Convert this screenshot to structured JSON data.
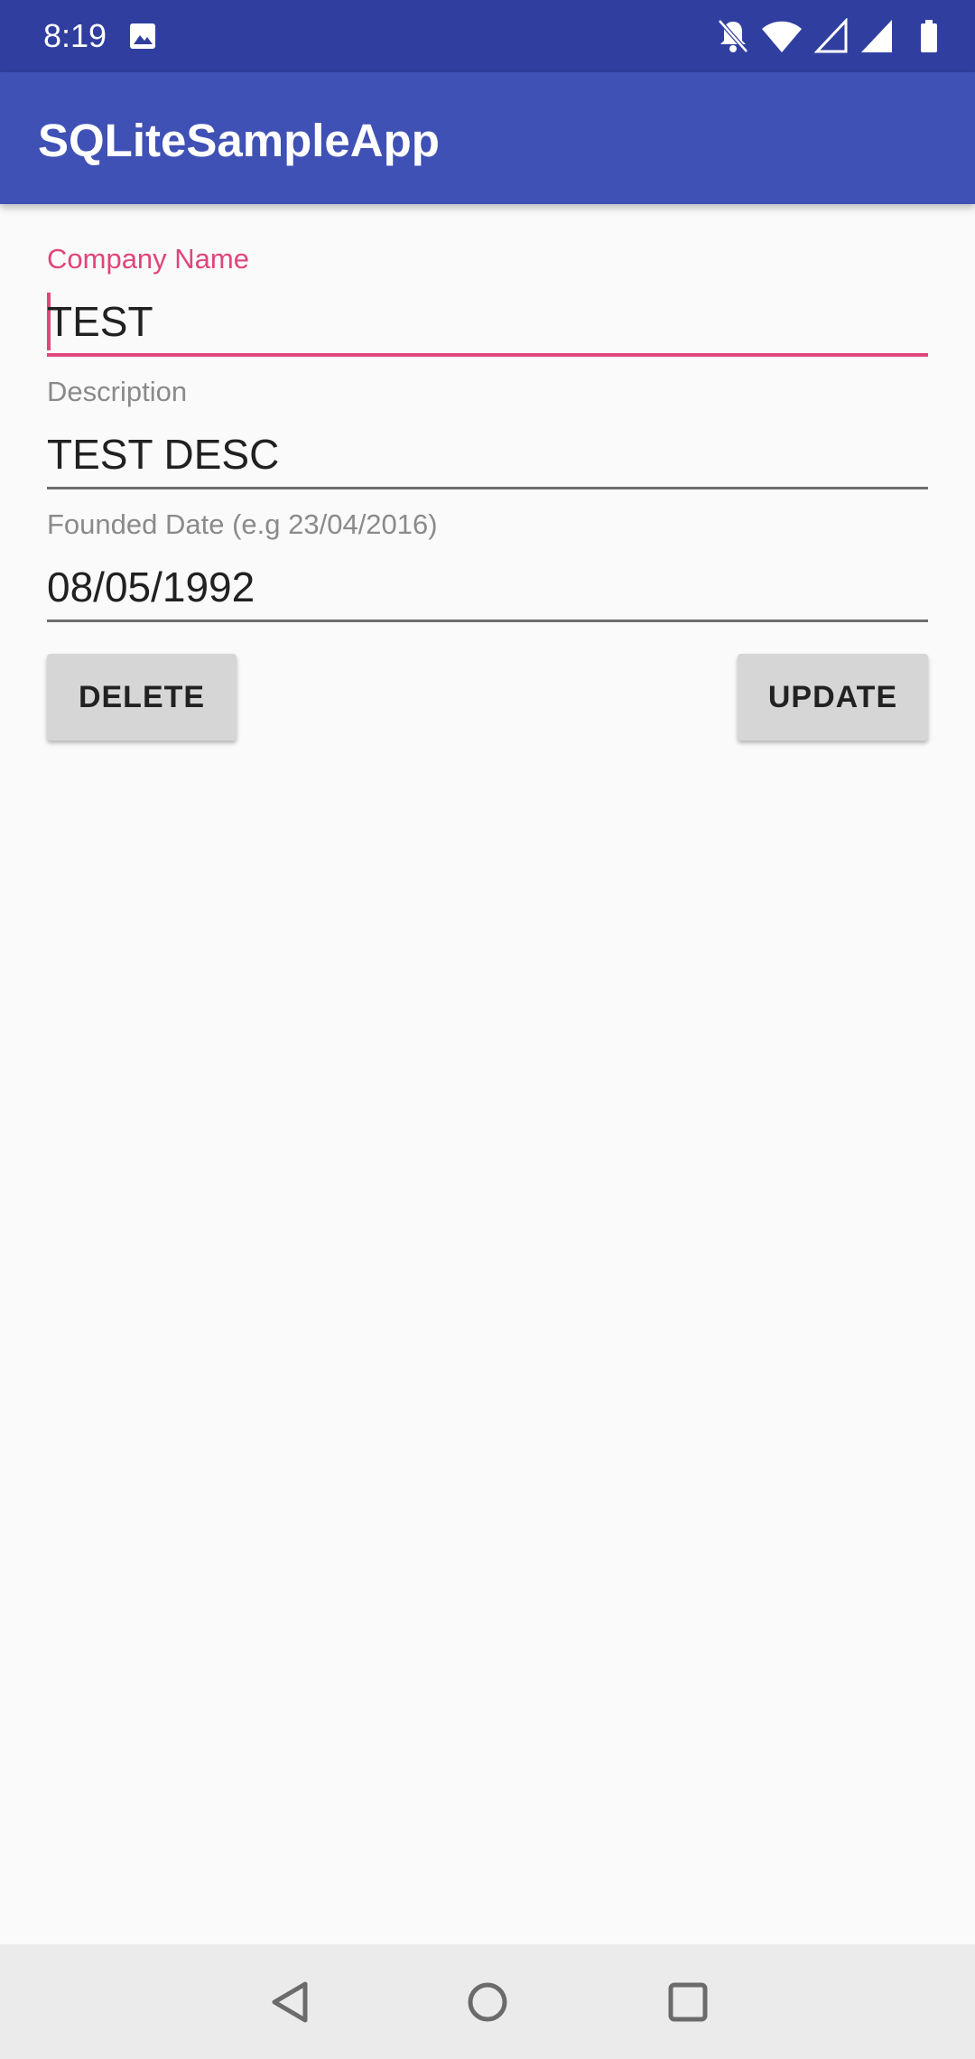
{
  "status_bar": {
    "time": "8:19",
    "icons": [
      "image-icon",
      "notifications-off-icon",
      "wifi-icon",
      "signal-empty-icon",
      "signal-full-icon",
      "battery-icon"
    ]
  },
  "app_bar": {
    "title": "SQLiteSampleApp",
    "color": "#3f51b5",
    "status_color": "#303f9f"
  },
  "form": {
    "company_name": {
      "label": "Company Name",
      "value": "TEST",
      "focused": true
    },
    "description": {
      "label": "Description",
      "value": "TEST DESC"
    },
    "founded_date": {
      "label": "Founded Date (e.g 23/04/2016)",
      "value": "08/05/1992"
    },
    "accent_color": "#e0457b"
  },
  "actions": {
    "delete_label": "DELETE",
    "update_label": "UPDATE"
  },
  "nav_bar": {
    "icons": [
      "back-icon",
      "home-icon",
      "recents-icon"
    ]
  }
}
